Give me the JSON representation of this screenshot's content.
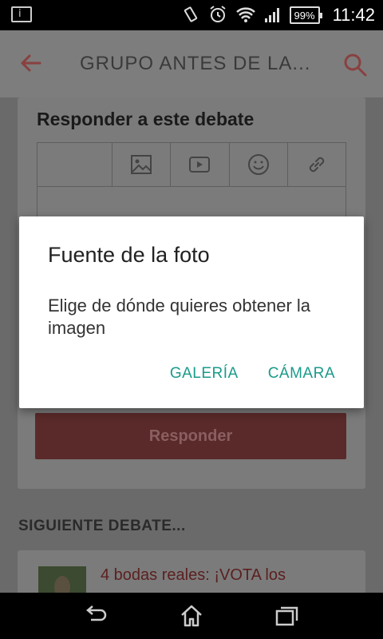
{
  "status_bar": {
    "notification_icon": "info-icon",
    "battery_percent": "99%",
    "time": "11:42"
  },
  "app_bar": {
    "title": "GRUPO ANTES DE LA...",
    "accent_color": "#d84848"
  },
  "reply_card": {
    "title": "Responder a este debate",
    "toolbar_icons": [
      "image-icon",
      "video-icon",
      "emoji-icon",
      "link-icon"
    ],
    "reply_button": "Responder"
  },
  "next_debate": {
    "header": "SIGUIENTE DEBATE...",
    "title": "4 bodas reales: ¡VOTA los"
  },
  "dialog": {
    "title": "Fuente de la foto",
    "message": "Elige de dónde quieres obtener la imagen",
    "buttons": {
      "gallery": "GALERÍA",
      "camera": "CÁMARA"
    },
    "button_color": "#1a9a8a"
  }
}
